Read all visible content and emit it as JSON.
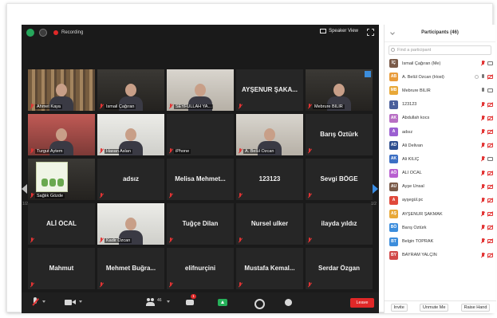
{
  "meeting": {
    "recording_label": "Recording",
    "speaker_view_label": "Speaker View",
    "colors": {
      "recording": "#e02828",
      "active_speaker": "#c7d940",
      "leave": "#e02828",
      "share": "#26b15a"
    }
  },
  "grid": {
    "page_left": "1/2",
    "page_right": "1/2",
    "tiles": [
      {
        "name": "Ahmet Kaya",
        "video": true,
        "bg": "books",
        "label": "small"
      },
      {
        "name": "İsmail Çağıran",
        "video": true,
        "bg": "dark",
        "label": "small"
      },
      {
        "name": "SEYFULLAH YA...",
        "video": true,
        "bg": "wall",
        "label": "small"
      },
      {
        "name": "AYŞENUR ŞAKA...",
        "video": false,
        "label": "big"
      },
      {
        "name": "Mebrure BİLİR",
        "video": true,
        "bg": "dark",
        "label": "small",
        "badge": true
      },
      {
        "name": "Turgut Aytem",
        "video": true,
        "bg": "red",
        "label": "small"
      },
      {
        "name": "Hasan Aslan",
        "video": true,
        "bg": "light",
        "label": "small"
      },
      {
        "name": "iPhone",
        "video": false,
        "label": "small"
      },
      {
        "name": "A. Belül Özcan",
        "video": true,
        "bg": "wall",
        "label": "small"
      },
      {
        "name": "Barış Öztürk",
        "video": false,
        "label": "big"
      },
      {
        "name": "Sağlık Gözde",
        "video": true,
        "bg": "plant",
        "label": "small"
      },
      {
        "name": "adsız",
        "video": false,
        "label": "big"
      },
      {
        "name": "Melisa Mehmet...",
        "video": false,
        "label": "big"
      },
      {
        "name": "123123",
        "video": false,
        "label": "big"
      },
      {
        "name": "Sevgi BÖGE",
        "video": false,
        "label": "big"
      },
      {
        "name": "ALİ ÖCAL",
        "video": false,
        "label": "big"
      },
      {
        "name": "Kadir Özcan",
        "video": true,
        "bg": "light",
        "label": "small",
        "active": true
      },
      {
        "name": "Tuğçe Dilan",
        "video": false,
        "label": "big"
      },
      {
        "name": "Nursel ulker",
        "video": false,
        "label": "big"
      },
      {
        "name": "ilayda yıldız",
        "video": false,
        "label": "big"
      },
      {
        "name": "Mahmut",
        "video": false,
        "label": "big"
      },
      {
        "name": "Mehmet Buğra...",
        "video": false,
        "label": "big"
      },
      {
        "name": "elifnurçini",
        "video": false,
        "label": "big"
      },
      {
        "name": "Mustafa Kemal...",
        "video": false,
        "label": "big"
      },
      {
        "name": "Serdar Özgan",
        "video": false,
        "label": "big"
      }
    ]
  },
  "toolbar": {
    "participants_count": "46",
    "chat_badge": "1",
    "leave_label": "Leave"
  },
  "panel": {
    "title": "Participants (46)",
    "search_placeholder": "Find a participant",
    "participants": [
      {
        "initials": "İÇ",
        "name": "İsmail Çağıran (Me)",
        "color": "#7a5a48",
        "mic": false,
        "cam": true
      },
      {
        "initials": "AB",
        "name": "A. Belül Özcan (Host)",
        "color": "#e89b3a",
        "mic": true,
        "cam": false,
        "hand": true
      },
      {
        "initials": "MB",
        "name": "Mebrure BİLİR",
        "color": "#e8a838",
        "mic": true,
        "cam": true
      },
      {
        "initials": "1",
        "name": "123123",
        "color": "#4a5f9c",
        "mic": false,
        "cam": false
      },
      {
        "initials": "AK",
        "name": "Abdullah kocs",
        "color": "#b86fc4",
        "mic": false,
        "cam": false
      },
      {
        "initials": "A",
        "name": "adsız",
        "color": "#9b5fd1",
        "mic": false,
        "cam": false
      },
      {
        "initials": "AD",
        "name": "Ali Delivan",
        "color": "#2f4f8f",
        "mic": false,
        "cam": false
      },
      {
        "initials": "AK",
        "name": "Ali KILIÇ",
        "color": "#3c6fc4",
        "mic": false,
        "cam": true
      },
      {
        "initials": "AÖ",
        "name": "ALİ ÖCAL",
        "color": "#b85fd0",
        "mic": false,
        "cam": false
      },
      {
        "initials": "AU",
        "name": "Ayşe Ünsal",
        "color": "#7a5a48",
        "mic": false,
        "cam": false
      },
      {
        "initials": "A",
        "name": "ayşegül.pc",
        "color": "#e0493a",
        "mic": false,
        "cam": false
      },
      {
        "initials": "AŞ",
        "name": "AYŞENUR ŞAKMAK",
        "color": "#e8a838",
        "mic": false,
        "cam": false
      },
      {
        "initials": "BÖ",
        "name": "Barış Öztürk",
        "color": "#3c8ddc",
        "mic": false,
        "cam": false
      },
      {
        "initials": "BT",
        "name": "Belgin TOPRAK",
        "color": "#3c8ddc",
        "mic": false,
        "cam": false
      },
      {
        "initials": "BY",
        "name": "BAYRAM YALÇIN",
        "color": "#d14a4a",
        "mic": false,
        "cam": false
      }
    ],
    "invite_label": "Invite",
    "unmute_label": "Unmute Me",
    "raise_hand_label": "Raise Hand"
  }
}
